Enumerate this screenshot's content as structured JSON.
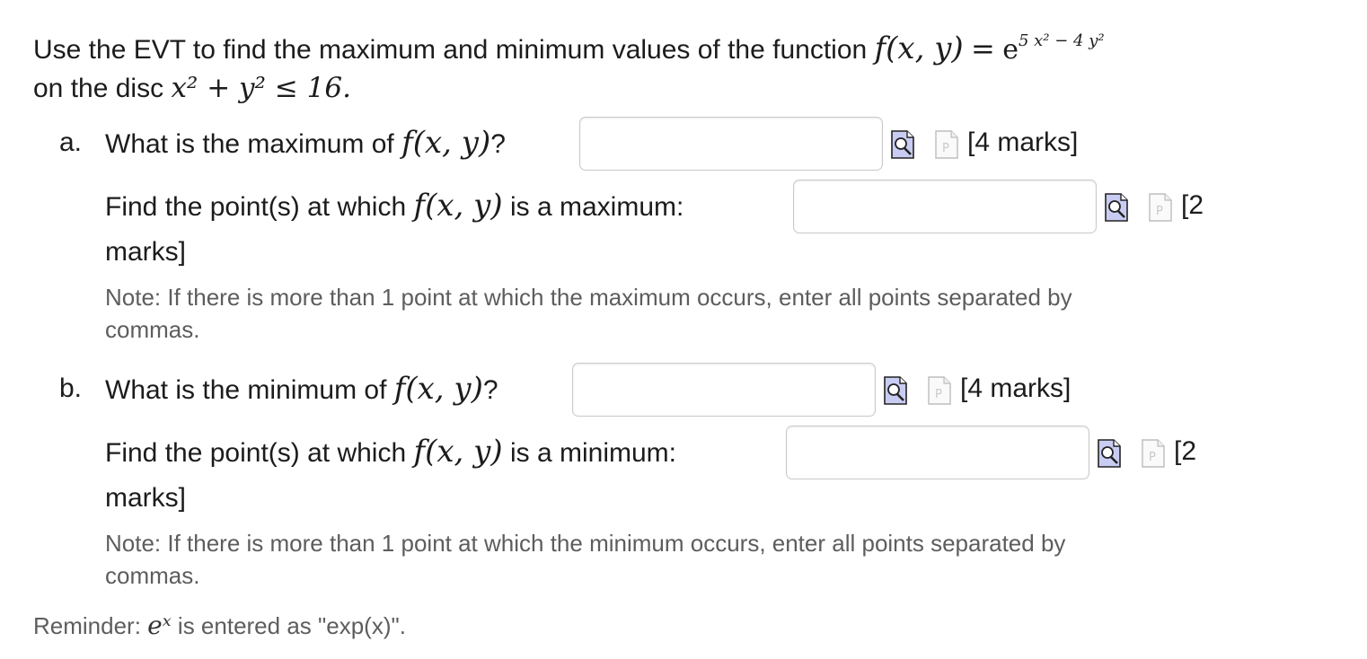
{
  "question": {
    "intro": "Use the EVT to find the maximum and minimum values of the function",
    "function_lhs": "f(x, y)",
    "equals": "=",
    "exp_base": "e",
    "exp_exponent": "5 x² − 4 y²",
    "disc_prefix": "on the disc",
    "disc_expr": "x² + y² ≤ 16."
  },
  "part_a": {
    "label": "a.",
    "max_question": "What is the maximum of",
    "func": "f(x, y)",
    "qmark": "?",
    "max_marks": "[4 marks]",
    "point_prefix": "Find the point(s) at which",
    "point_suffix": "is a maximum:",
    "point_marks_open": "[2",
    "point_marks_close": "marks]",
    "note_line1": "Note: If there is more than 1 point at which the maximum occurs, enter all points separated by",
    "note_line2": "commas.",
    "max_value": "",
    "point_value": ""
  },
  "part_b": {
    "label": "b.",
    "min_question": "What is the minimum of",
    "func": "f(x, y)",
    "qmark": "?",
    "min_marks": "[4 marks]",
    "point_prefix": "Find the point(s) at which",
    "point_suffix": "is a minimum:",
    "point_marks_open": "[2",
    "point_marks_close": "marks]",
    "note_line1": "Note: If there is more than 1 point at which the minimum occurs, enter all points separated by",
    "note_line2": "commas.",
    "min_value": "",
    "point_value": ""
  },
  "reminder": {
    "prefix": "Reminder:",
    "math": "eˣ",
    "suffix": "is entered as \"exp(x)\"."
  },
  "icons": {
    "preview": "preview-magnifier-icon",
    "parse": "parse-document-icon"
  }
}
